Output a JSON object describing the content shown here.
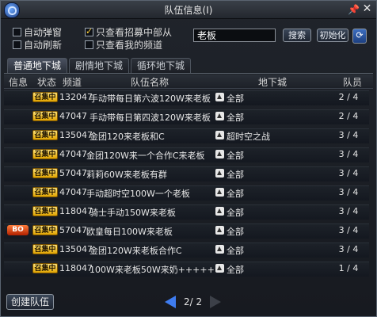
{
  "window": {
    "title": "队伍信息(Ⅰ)"
  },
  "filters": {
    "auto_popup": {
      "label": "自动弹窗",
      "checked": false
    },
    "auto_refresh": {
      "label": "自动刷新",
      "checked": false
    },
    "only_recruiting": {
      "label": "只查看招募中部从",
      "checked": true
    },
    "only_my_channel": {
      "label": "只查看我的频道",
      "checked": false
    },
    "search_value": "老板",
    "search_button": "搜索",
    "reset_button": "初始化"
  },
  "tabs": [
    "普通地下城",
    "剧情地下城",
    "循环地下城"
  ],
  "columns": {
    "info": "信息",
    "status": "状态",
    "channel": "频道",
    "team_name": "队伍名称",
    "dungeon": "地下城",
    "members": "队员"
  },
  "rows": [
    {
      "badge": "召集中",
      "channel": "132047",
      "name": "手动带每日第六波120W来老板",
      "dungeon": "全部",
      "members": "2 / 4",
      "info_icon": ""
    },
    {
      "badge": "召集中",
      "channel": "47047",
      "name": "手动带每日第四波120W来老板",
      "dungeon": "全部",
      "members": "2 / 4",
      "info_icon": ""
    },
    {
      "badge": "召集中",
      "channel": "135047",
      "name": "金团120来老板和C",
      "dungeon": "超时空之战",
      "members": "3 / 4",
      "info_icon": ""
    },
    {
      "badge": "召集中",
      "channel": "47047",
      "name": "金团120W来一个合作C来老板",
      "dungeon": "全部",
      "members": "3 / 4",
      "info_icon": ""
    },
    {
      "badge": "召集中",
      "channel": "57047",
      "name": "莉莉60W来老板有群",
      "dungeon": "全部",
      "members": "3 / 4",
      "info_icon": ""
    },
    {
      "badge": "召集中",
      "channel": "47047",
      "name": "手动超时空100W一个老板",
      "dungeon": "全部",
      "members": "3 / 4",
      "info_icon": ""
    },
    {
      "badge": "召集中",
      "channel": "118047",
      "name": "骑士手动150W来老板",
      "dungeon": "全部",
      "members": "3 / 4",
      "info_icon": ""
    },
    {
      "badge": "召集中",
      "channel": "57047",
      "name": "欧皇每日100W来老板",
      "dungeon": "全部",
      "members": "3 / 4",
      "info_icon": "BO"
    },
    {
      "badge": "召集中",
      "channel": "135047",
      "name": "金团120W来老板合作C",
      "dungeon": "全部",
      "members": "3 / 4",
      "info_icon": ""
    },
    {
      "badge": "召集中",
      "channel": "118047",
      "name": "100W来老板50W来奶++++++",
      "dungeon": "全部",
      "members": "1 / 4",
      "info_icon": ""
    }
  ],
  "footer": {
    "create_button": "创建队伍",
    "page": "2/ 2"
  },
  "colors": {
    "badge": "#f0b800",
    "accent_blue": "#3e7cf0"
  }
}
